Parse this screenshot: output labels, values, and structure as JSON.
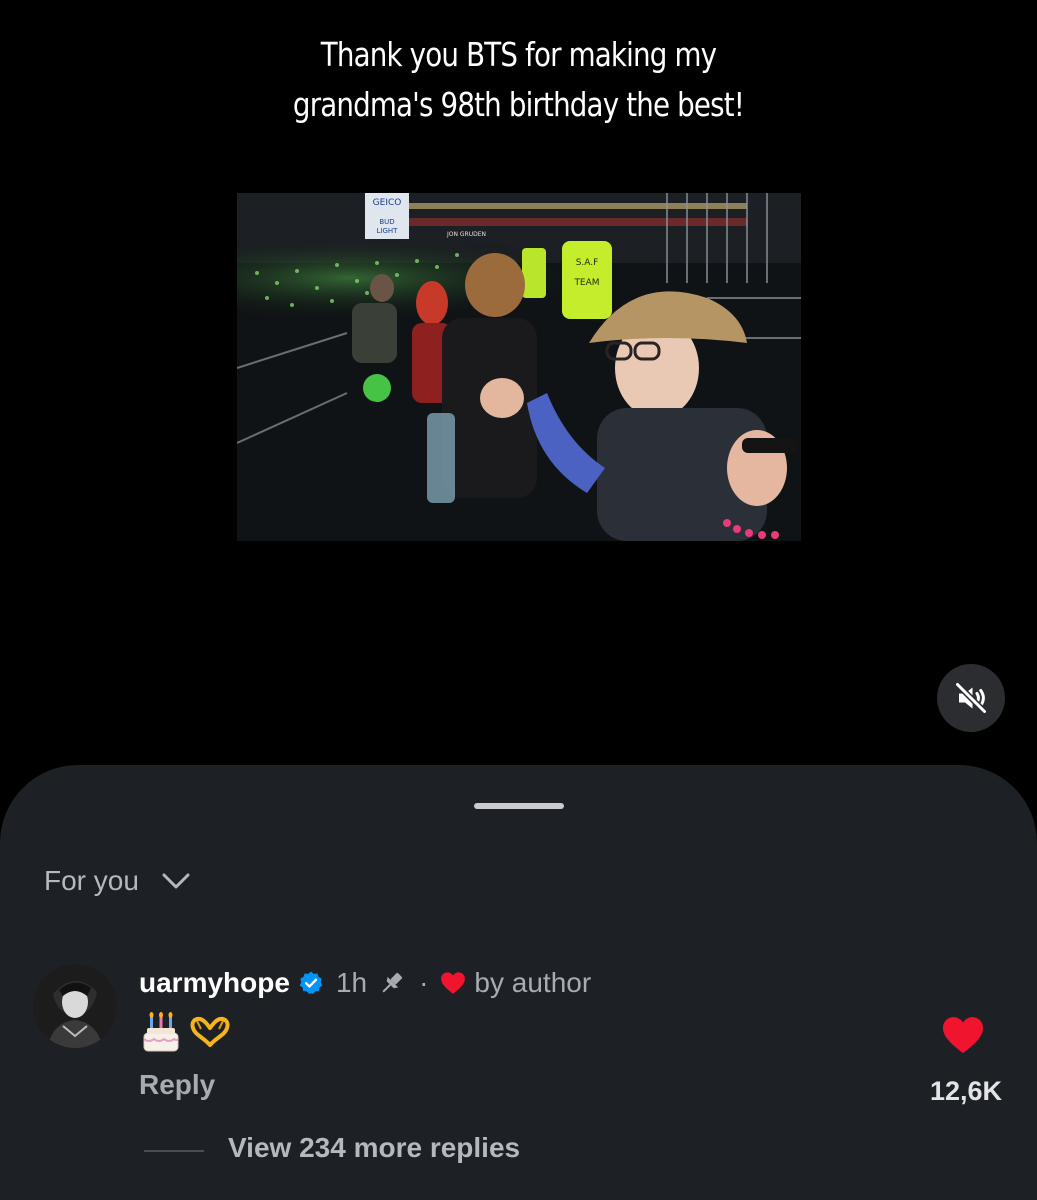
{
  "video": {
    "caption_line1": "Thank you BTS for making my",
    "caption_line2": "grandma's 98th birthday the best!",
    "sign_geico": "GEICO",
    "sign_bud": "BUD",
    "sign_light": "LIGHT",
    "sign_ring": "JON GRUDEN",
    "vest_line1": "S.A.F",
    "vest_line2": "TEAM",
    "mute_icon": "speaker-muted-icon"
  },
  "comments": {
    "filter_label": "For you",
    "filter_icon": "chevron-down-icon",
    "items": [
      {
        "username": "uarmyhope",
        "time": "1h",
        "separator": "·",
        "liked_by": "by author",
        "emoji_1": "🎂",
        "emoji_2": "🫶",
        "reply_label": "Reply",
        "like_count": "12,6K",
        "view_replies": "View 234 more replies"
      }
    ]
  },
  "colors": {
    "background": "#000000",
    "sheet": "#1d2024",
    "heart": "#f0142f",
    "verified": "#0095f6",
    "text_secondary": "#a8abb0"
  }
}
